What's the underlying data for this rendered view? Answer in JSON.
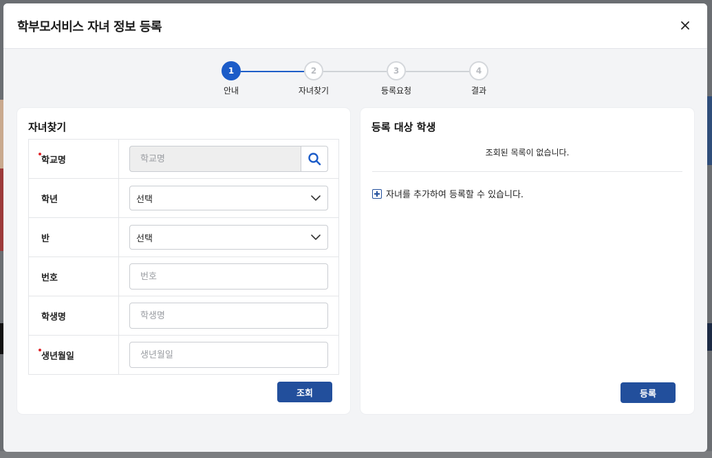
{
  "modal": {
    "title": "학부모서비스 자녀 정보 등록",
    "close_icon": "close-icon"
  },
  "stepper": {
    "steps": [
      {
        "number": "1",
        "label": "안내",
        "active": true
      },
      {
        "number": "2",
        "label": "자녀찾기",
        "active": false
      },
      {
        "number": "3",
        "label": "등록요청",
        "active": false
      },
      {
        "number": "4",
        "label": "결과",
        "active": false
      }
    ]
  },
  "search_panel": {
    "title": "자녀찾기",
    "fields": {
      "school": {
        "label": "학교명",
        "placeholder": "학교명",
        "required": true
      },
      "grade": {
        "label": "학년",
        "value": "선택"
      },
      "class": {
        "label": "반",
        "value": "선택"
      },
      "number": {
        "label": "번호",
        "placeholder": "번호"
      },
      "student_name": {
        "label": "학생명",
        "placeholder": "학생명"
      },
      "birthdate": {
        "label": "생년월일",
        "placeholder": "생년월일",
        "required": true
      }
    },
    "search_button": "조회"
  },
  "result_panel": {
    "title": "등록 대상 학생",
    "empty_message": "조회된 목록이 없습니다.",
    "add_hint": "자녀를 추가하여 등록할 수 있습니다.",
    "register_button": "등록"
  },
  "colors": {
    "accent": "#1c5cc8",
    "button": "#224f9c",
    "required": "#e0262b"
  }
}
